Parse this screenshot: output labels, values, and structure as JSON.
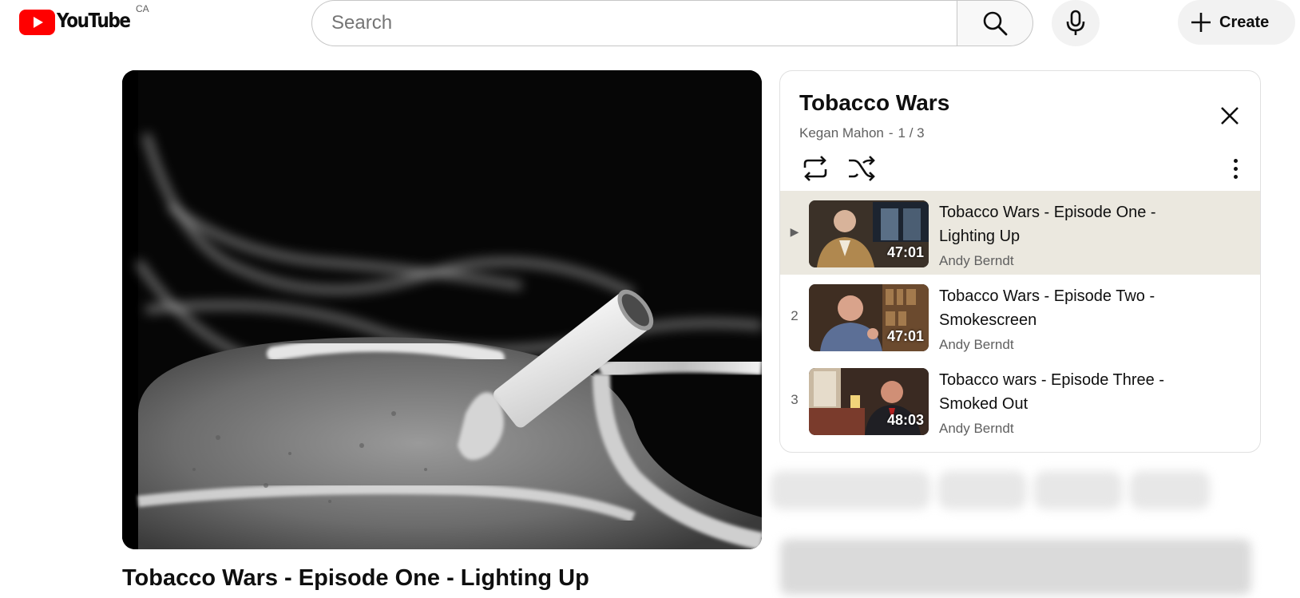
{
  "header": {
    "logo_text": "YouTube",
    "country_code": "CA",
    "search_placeholder": "Search",
    "create_label": "Create",
    "icons": [
      "youtube-logo-icon",
      "search-icon",
      "microphone-icon",
      "plus-icon"
    ],
    "brand_color": "#ff0000"
  },
  "video": {
    "title": "Tobacco Wars - Episode One - Lighting Up"
  },
  "playlist": {
    "title": "Tobacco Wars",
    "owner": "Kegan Mahon",
    "position": "1 / 3",
    "meta_separator": "-",
    "icons": [
      "close-icon",
      "loop-icon",
      "shuffle-icon",
      "more-vert-icon"
    ],
    "items": [
      {
        "index": "▶",
        "title": "Tobacco Wars - Episode One - Lighting Up",
        "channel": "Andy Berndt",
        "duration": "47:01",
        "active": true
      },
      {
        "index": "2",
        "title": "Tobacco Wars - Episode Two - Smokescreen",
        "channel": "Andy Berndt",
        "duration": "47:01",
        "active": false
      },
      {
        "index": "3",
        "title": "Tobacco wars - Episode Three - Smoked Out",
        "channel": "Andy Berndt",
        "duration": "48:03",
        "active": false
      }
    ],
    "active_bg": "#ebe8df"
  }
}
